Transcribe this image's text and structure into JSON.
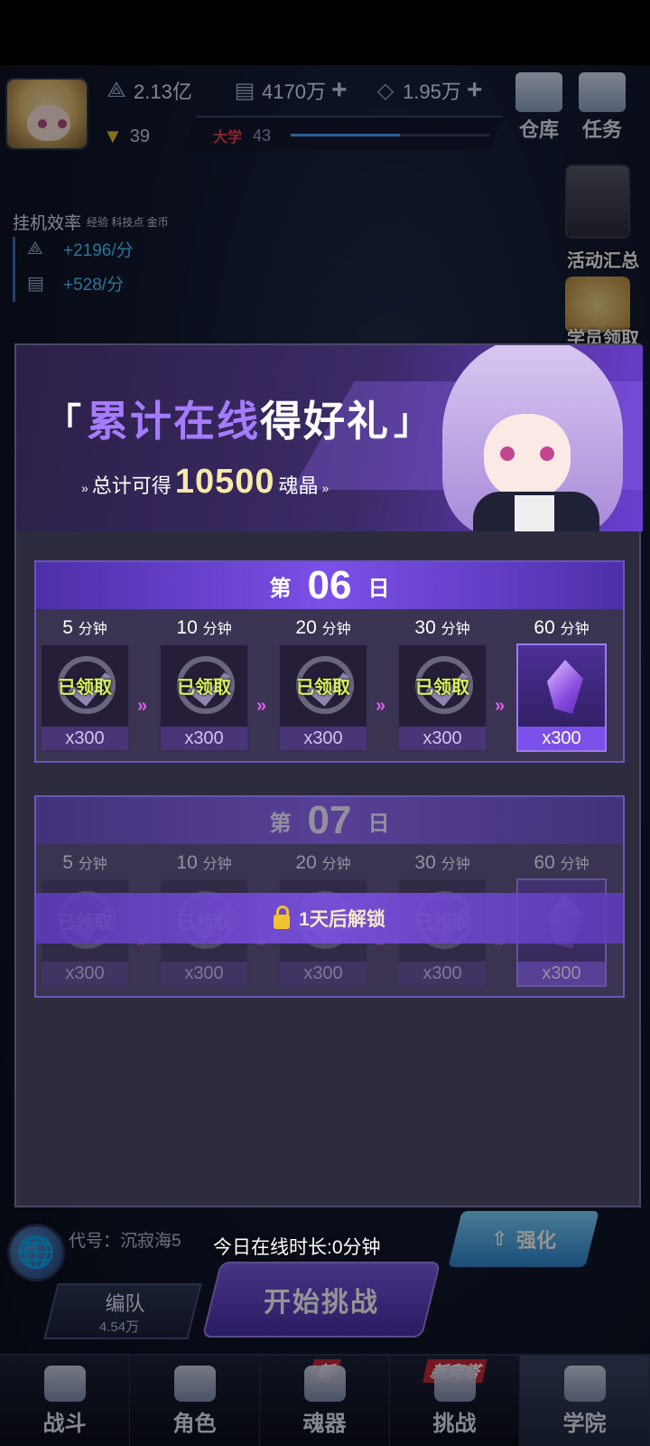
{
  "resources": {
    "exp": "2.13亿",
    "coins": "4170万",
    "crystals": "1.95万",
    "level": "39",
    "school_tag": "大学",
    "school_level": "43",
    "school_progress": 0.55
  },
  "top_buttons": {
    "warehouse": "仓库",
    "tasks": "任务"
  },
  "idle": {
    "title": "挂机效率",
    "subtitle": "经验 科技点 金币",
    "exp_rate": "+2196/分",
    "coin_rate": "+528/分"
  },
  "side": {
    "events": "活动汇总",
    "academy": "学员领取"
  },
  "modal": {
    "title_quote_open": "「",
    "title_part_a": "累计在线",
    "title_part_b": "得好礼",
    "title_quote_close": "」",
    "subtitle_prefix": "总计可得",
    "subtitle_amount": "10500",
    "subtitle_suffix": "魂晶"
  },
  "days": [
    {
      "prefix": "第",
      "number": "06",
      "suffix": "日",
      "rewards": [
        {
          "minutes": "5",
          "unit": "分钟",
          "status": "已领取",
          "qty": "x300",
          "claimed": true
        },
        {
          "minutes": "10",
          "unit": "分钟",
          "status": "已领取",
          "qty": "x300",
          "claimed": true
        },
        {
          "minutes": "20",
          "unit": "分钟",
          "status": "已领取",
          "qty": "x300",
          "claimed": true
        },
        {
          "minutes": "30",
          "unit": "分钟",
          "status": "已领取",
          "qty": "x300",
          "claimed": true
        },
        {
          "minutes": "60",
          "unit": "分钟",
          "status": "",
          "qty": "x300",
          "claimed": false
        }
      ]
    },
    {
      "prefix": "第",
      "number": "07",
      "suffix": "日",
      "lock_text": "1天后解锁",
      "rewards": [
        {
          "minutes": "5",
          "unit": "分钟",
          "status": "已领取",
          "qty": "x300",
          "claimed": true
        },
        {
          "minutes": "10",
          "unit": "分钟",
          "status": "已领取",
          "qty": "x300",
          "claimed": true
        },
        {
          "minutes": "20",
          "unit": "分钟",
          "status": "已领取",
          "qty": "x300",
          "claimed": true
        },
        {
          "minutes": "30",
          "unit": "分钟",
          "status": "已领取",
          "qty": "x300",
          "claimed": true
        },
        {
          "minutes": "60",
          "unit": "分钟",
          "status": "",
          "qty": "x300",
          "claimed": false
        }
      ]
    }
  ],
  "bottom": {
    "code_label": "代号：沉寂海5",
    "online_today": "今日在线时长:0分钟",
    "strengthen": "强化",
    "team": "编队",
    "team_power": "4.54万",
    "start": "开始挑战"
  },
  "nav": [
    {
      "label": "战斗",
      "badge": ""
    },
    {
      "label": "角色",
      "badge": ""
    },
    {
      "label": "魂器",
      "badge": "新"
    },
    {
      "label": "挑战",
      "badge": "新爬塔"
    },
    {
      "label": "学院",
      "badge": ""
    }
  ]
}
